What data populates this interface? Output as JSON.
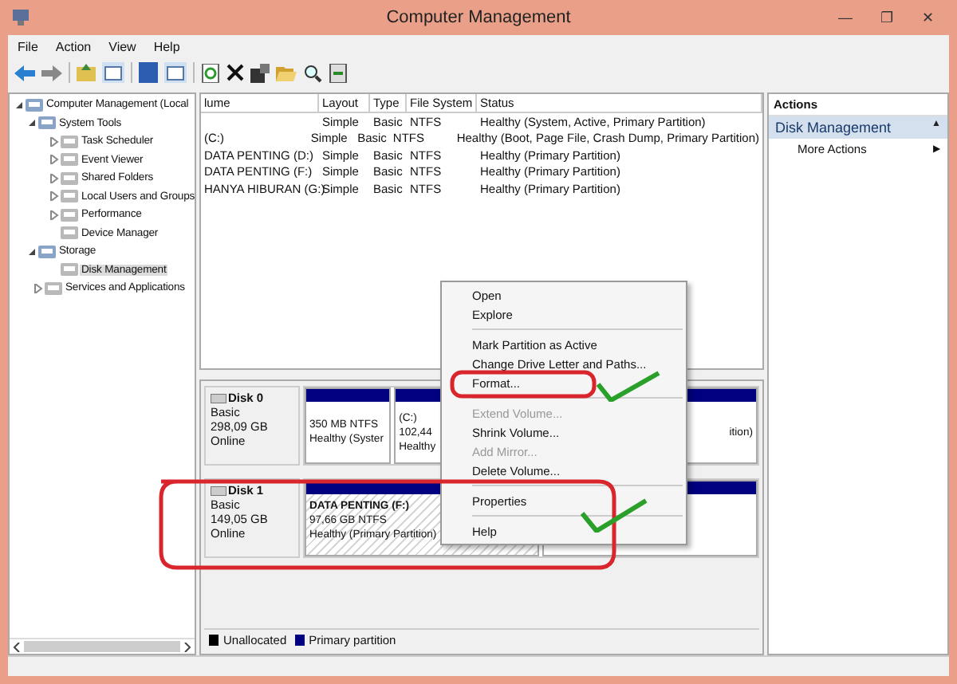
{
  "window": {
    "title": "Computer Management",
    "controls": [
      "—",
      "❐",
      "✕"
    ]
  },
  "menu_bar": [
    "File",
    "Action",
    "View",
    "Help"
  ],
  "tree": [
    {
      "label": "Computer Management (Local",
      "expanded": true,
      "selected": false,
      "children": [
        {
          "label": "System Tools",
          "expanded": true,
          "selected": false,
          "children": [
            {
              "label": "Task Scheduler",
              "expanded": false,
              "selected": false
            },
            {
              "label": "Event Viewer",
              "expanded": false,
              "selected": false
            },
            {
              "label": "Shared Folders",
              "expanded": false,
              "selected": false
            },
            {
              "label": "Local Users and Groups",
              "expanded": false,
              "selected": false
            },
            {
              "label": "Performance",
              "expanded": false,
              "selected": false
            },
            {
              "label": "Device Manager",
              "selected": false
            }
          ]
        },
        {
          "label": "Storage",
          "expanded": true,
          "selected": false,
          "children": [
            {
              "label": "Disk Management",
              "selected": true
            }
          ]
        },
        {
          "label": "Services and Applications",
          "expanded": false,
          "selected": false
        }
      ]
    }
  ],
  "volume_table": {
    "columns": [
      "lume",
      "Layout",
      "Type",
      "File System",
      "Status"
    ],
    "rows": [
      [
        "",
        "Simple",
        "Basic",
        "NTFS",
        "Healthy (System, Active, Primary Partition)"
      ],
      [
        "(C:)",
        "Simple",
        "Basic",
        "NTFS",
        "Healthy (Boot, Page File, Crash Dump, Primary Partition)"
      ],
      [
        "DATA PENTING (D:)",
        "Simple",
        "Basic",
        "NTFS",
        "Healthy (Primary Partition)"
      ],
      [
        "DATA PENTING (F:)",
        "Simple",
        "Basic",
        "NTFS",
        "Healthy (Primary Partition)"
      ],
      [
        "HANYA HIBURAN (G:)",
        "Simple",
        "Basic",
        "NTFS",
        "Healthy (Primary Partition)"
      ]
    ]
  },
  "disks": [
    {
      "name": "Disk 0",
      "type": "Basic",
      "size": "298,09 GB",
      "status": "Online",
      "partitions": [
        {
          "lines": [
            "350 MB NTFS",
            "Healthy (Syster"
          ],
          "selected": false
        },
        {
          "title": "(C:)",
          "lines": [
            "102,44",
            "Healthy"
          ],
          "selected": false
        },
        {
          "lines": [
            "ition)"
          ],
          "selected": false
        }
      ]
    },
    {
      "name": "Disk 1",
      "type": "Basic",
      "size": "149,05 GB",
      "status": "Online",
      "partitions": [
        {
          "title": "DATA PENTING  (F:)",
          "lines": [
            "97,66 GB NTFS",
            "Healthy (Primary Partition)"
          ],
          "selected": true
        },
        {
          "selected": false
        }
      ]
    }
  ],
  "legend": [
    {
      "label": "Unallocated",
      "color": "#000000"
    },
    {
      "label": "Primary partition",
      "color": "#000080"
    }
  ],
  "actions": {
    "title": "Actions",
    "section": "Disk Management",
    "section_arrow": "▲",
    "items": [
      {
        "label": "More Actions",
        "arrow": "▶"
      }
    ]
  },
  "context_menu": [
    {
      "kind": "item",
      "label": "Open",
      "disabled": false
    },
    {
      "kind": "item",
      "label": "Explore",
      "disabled": false
    },
    {
      "kind": "separator"
    },
    {
      "kind": "item",
      "label": "Mark Partition as Active",
      "disabled": false
    },
    {
      "kind": "item",
      "label": "Change Drive Letter and Paths...",
      "disabled": false
    },
    {
      "kind": "item",
      "label": "Format...",
      "disabled": false
    },
    {
      "kind": "separator"
    },
    {
      "kind": "item",
      "label": "Extend Volume...",
      "disabled": true
    },
    {
      "kind": "item",
      "label": "Shrink Volume...",
      "disabled": false
    },
    {
      "kind": "item",
      "label": "Add Mirror...",
      "disabled": true
    },
    {
      "kind": "item",
      "label": "Delete Volume...",
      "disabled": false
    },
    {
      "kind": "separator"
    },
    {
      "kind": "item",
      "label": "Properties",
      "disabled": false
    },
    {
      "kind": "separator"
    },
    {
      "kind": "item",
      "label": "Help",
      "disabled": false
    }
  ]
}
